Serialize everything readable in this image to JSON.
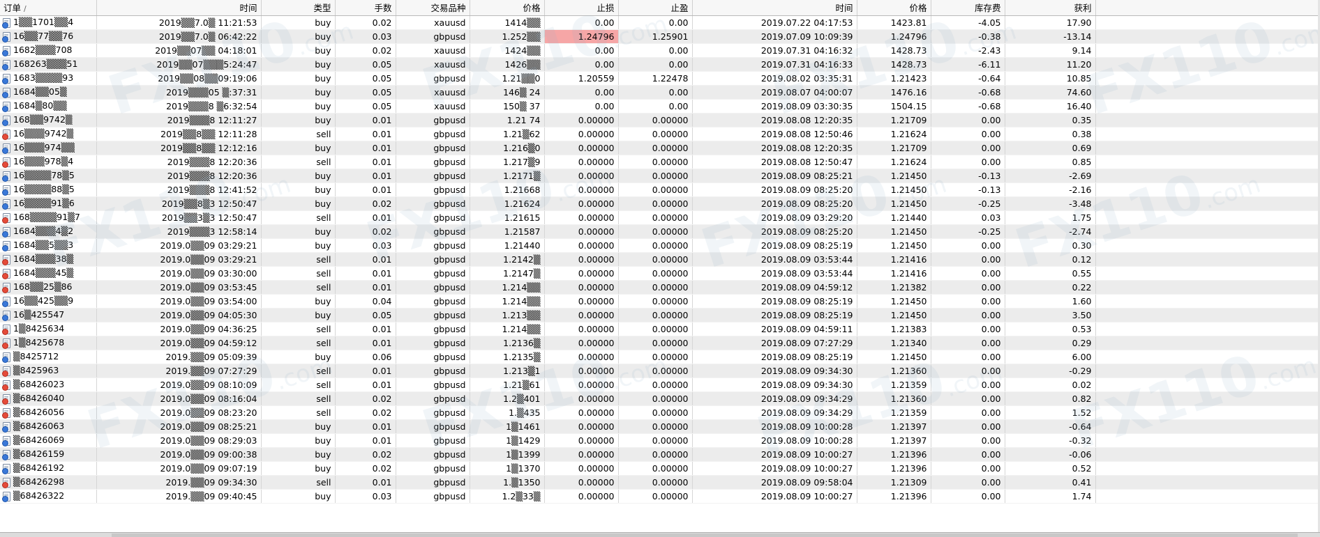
{
  "columns": [
    {
      "label": "订单",
      "sort": "∕"
    },
    {
      "label": "时间"
    },
    {
      "label": "类型"
    },
    {
      "label": "手数"
    },
    {
      "label": "交易品种"
    },
    {
      "label": "价格"
    },
    {
      "label": "止损"
    },
    {
      "label": "止盈"
    },
    {
      "label": "时间"
    },
    {
      "label": "价格"
    },
    {
      "label": "库存费"
    },
    {
      "label": "获利"
    }
  ],
  "watermark": {
    "brand": "FX110",
    "suffix": ".com"
  },
  "highlight": {
    "sl_color": "#f6a6a6",
    "buy_color": "#3a78d8",
    "sell_color": "#e44b3a"
  },
  "rows": [
    [
      "1▒▒1701▒▒4",
      "2019▒▒7.0▒ 11:21:53",
      "buy",
      "0.02",
      "xauusd",
      "1414▒▒",
      "0.00",
      "0.00",
      "2019.07.22 04:17:53",
      "1423.81",
      "-4.05",
      "17.90"
    ],
    [
      "16▒▒77▒▒76",
      "2019▒▒7.0▒ 06:42:22",
      "buy",
      "0.03",
      "gbpusd",
      "1.252▒▒",
      "1.24796",
      "1.25901",
      "2019.07.09 10:09:39",
      "1.24796",
      "-0.38",
      "-13.14"
    ],
    [
      "1682▒▒▒708",
      "2019▒▒07▒▒ 04:18:01",
      "buy",
      "0.02",
      "xauusd",
      "1424▒▒",
      "0.00",
      "0.00",
      "2019.07.31 04:16:32",
      "1428.73",
      "-2.43",
      "9.14"
    ],
    [
      "168263▒▒▒51",
      "2019▒▒07▒▒▒5:24:47",
      "buy",
      "0.05",
      "xauusd",
      "1426▒▒",
      "0.00",
      "0.00",
      "2019.07.31 04:16:33",
      "1428.73",
      "-6.11",
      "11.20"
    ],
    [
      "1683▒▒▒▒93",
      "2019▒▒08▒▒09:19:06",
      "buy",
      "0.05",
      "gbpusd",
      "1.21▒▒0",
      "1.20559",
      "1.22478",
      "2019.08.02 03:35:31",
      "1.21423",
      "-0.64",
      "10.85"
    ],
    [
      "1684▒▒05▒",
      "2019▒▒▒05 ▒:37:31",
      "buy",
      "0.05",
      "xauusd",
      "146▒ 24",
      "0.00",
      "0.00",
      "2019.08.07 04:00:07",
      "1476.16",
      "-0.68",
      "74.60"
    ],
    [
      "1684▒80▒▒",
      "2019▒▒▒8 ▒6:32:54",
      "buy",
      "0.05",
      "xauusd",
      "150▒ 37",
      "0.00",
      "0.00",
      "2019.08.09 03:30:35",
      "1504.15",
      "-0.68",
      "16.40"
    ],
    [
      "168▒▒9742▒",
      "2019▒▒▒8 12:11:27",
      "buy",
      "0.01",
      "gbpusd",
      "1.21 74",
      "0.00000",
      "0.00000",
      "2019.08.08 12:20:35",
      "1.21709",
      "0.00",
      "0.35"
    ],
    [
      "16▒▒▒9742▒",
      "2019▒▒8▒▒ 12:11:28",
      "sell",
      "0.01",
      "gbpusd",
      "1.21▒62",
      "0.00000",
      "0.00000",
      "2019.08.08 12:50:46",
      "1.21624",
      "0.00",
      "0.38"
    ],
    [
      "16▒▒▒974▒▒",
      "2019▒▒8▒▒ 12:12:16",
      "buy",
      "0.01",
      "gbpusd",
      "1.216▒0",
      "0.00000",
      "0.00000",
      "2019.08.08 12:20:35",
      "1.21709",
      "0.00",
      "0.69"
    ],
    [
      "16▒▒▒978▒4",
      "2019▒▒▒8 12:20:36",
      "sell",
      "0.01",
      "gbpusd",
      "1.217▒9",
      "0.00000",
      "0.00000",
      "2019.08.08 12:50:47",
      "1.21624",
      "0.00",
      "0.85"
    ],
    [
      "16▒▒▒▒78▒5",
      "2019▒▒▒8 12:20:36",
      "buy",
      "0.01",
      "gbpusd",
      "1.2171▒",
      "0.00000",
      "0.00000",
      "2019.08.09 08:25:21",
      "1.21450",
      "-0.13",
      "-2.69"
    ],
    [
      "16▒▒▒▒88▒5",
      "2019▒▒▒8 12:41:52",
      "buy",
      "0.01",
      "gbpusd",
      "1.21668",
      "0.00000",
      "0.00000",
      "2019.08.09 08:25:20",
      "1.21450",
      "-0.13",
      "-2.16"
    ],
    [
      "16▒▒▒▒91▒6",
      "2019▒▒8▒3 12:50:47",
      "buy",
      "0.02",
      "gbpusd",
      "1.21624",
      "0.00000",
      "0.00000",
      "2019.08.09 08:25:20",
      "1.21450",
      "-0.25",
      "-3.48"
    ],
    [
      "168▒▒▒▒91▒7",
      "2019▒▒3▒3 12:50:47",
      "sell",
      "0.01",
      "gbpusd",
      "1.21615",
      "0.00000",
      "0.00000",
      "2019.08.09 03:29:20",
      "1.21440",
      "0.03",
      "1.75"
    ],
    [
      "1684▒▒▒4▒2",
      "2019▒▒▒3 12:58:14",
      "buy",
      "0.02",
      "gbpusd",
      "1.21587",
      "0.00000",
      "0.00000",
      "2019.08.09 08:25:20",
      "1.21450",
      "-0.25",
      "-2.74"
    ],
    [
      "1684▒▒5▒▒3",
      "2019.0▒▒09 03:29:21",
      "buy",
      "0.03",
      "gbpusd",
      "1.21440",
      "0.00000",
      "0.00000",
      "2019.08.09 08:25:19",
      "1.21450",
      "0.00",
      "0.30"
    ],
    [
      "1684▒▒▒38▒",
      "2019.0▒▒09 03:29:21",
      "sell",
      "0.01",
      "gbpusd",
      "1.2142▒",
      "0.00000",
      "0.00000",
      "2019.08.09 03:53:44",
      "1.21416",
      "0.00",
      "0.12"
    ],
    [
      "1684▒▒▒45▒",
      "2019.0▒▒09 03:30:00",
      "sell",
      "0.01",
      "gbpusd",
      "1.2147▒",
      "0.00000",
      "0.00000",
      "2019.08.09 03:53:44",
      "1.21416",
      "0.00",
      "0.55"
    ],
    [
      "168▒▒25▒86",
      "2019.0▒▒09 03:53:45",
      "sell",
      "0.01",
      "gbpusd",
      "1.214▒▒",
      "0.00000",
      "0.00000",
      "2019.08.09 04:59:12",
      "1.21382",
      "0.00",
      "0.22"
    ],
    [
      "16▒▒425▒▒9",
      "2019.0▒▒09 03:54:00",
      "buy",
      "0.04",
      "gbpusd",
      "1.214▒▒",
      "0.00000",
      "0.00000",
      "2019.08.09 08:25:19",
      "1.21450",
      "0.00",
      "1.60"
    ],
    [
      "16▒425547",
      "2019.0▒▒09 04:05:30",
      "buy",
      "0.05",
      "gbpusd",
      "1.213▒▒",
      "0.00000",
      "0.00000",
      "2019.08.09 08:25:19",
      "1.21450",
      "0.00",
      "3.50"
    ],
    [
      "1▒8425634",
      "2019.0▒▒09 04:36:25",
      "sell",
      "0.01",
      "gbpusd",
      "1.214▒▒",
      "0.00000",
      "0.00000",
      "2019.08.09 04:59:11",
      "1.21383",
      "0.00",
      "0.53"
    ],
    [
      "1▒8425678",
      "2019.0▒▒09 04:59:12",
      "sell",
      "0.01",
      "gbpusd",
      "1.2136▒",
      "0.00000",
      "0.00000",
      "2019.08.09 07:27:29",
      "1.21340",
      "0.00",
      "0.29"
    ],
    [
      "▒8425712",
      "2019.▒▒09 05:09:39",
      "buy",
      "0.06",
      "gbpusd",
      "1.2135▒",
      "0.00000",
      "0.00000",
      "2019.08.09 08:25:19",
      "1.21450",
      "0.00",
      "6.00"
    ],
    [
      "▒8425963",
      "2019.▒▒09 07:27:29",
      "sell",
      "0.01",
      "gbpusd",
      "1.213▒1",
      "0.00000",
      "0.00000",
      "2019.08.09 09:34:30",
      "1.21360",
      "0.00",
      "-0.29"
    ],
    [
      "▒68426023",
      "2019.0▒▒09 08:10:09",
      "sell",
      "0.01",
      "gbpusd",
      "1.21▒61",
      "0.00000",
      "0.00000",
      "2019.08.09 09:34:30",
      "1.21359",
      "0.00",
      "0.02"
    ],
    [
      "▒68426040",
      "2019.0▒▒09 08:16:04",
      "sell",
      "0.02",
      "gbpusd",
      "1.2▒401",
      "0.00000",
      "0.00000",
      "2019.08.09 09:34:29",
      "1.21360",
      "0.00",
      "0.82"
    ],
    [
      "▒68426056",
      "2019.0▒▒09 08:23:20",
      "sell",
      "0.02",
      "gbpusd",
      "1.▒435",
      "0.00000",
      "0.00000",
      "2019.08.09 09:34:29",
      "1.21359",
      "0.00",
      "1.52"
    ],
    [
      "▒68426063",
      "2019.0▒▒09 08:25:21",
      "buy",
      "0.01",
      "gbpusd",
      "1▒1461",
      "0.00000",
      "0.00000",
      "2019.08.09 10:00:28",
      "1.21397",
      "0.00",
      "-0.64"
    ],
    [
      "▒68426069",
      "2019.0▒▒09 08:29:03",
      "buy",
      "0.01",
      "gbpusd",
      "1▒1429",
      "0.00000",
      "0.00000",
      "2019.08.09 10:00:28",
      "1.21397",
      "0.00",
      "-0.32"
    ],
    [
      "▒68426159",
      "2019.0▒▒09 09:00:38",
      "buy",
      "0.02",
      "gbpusd",
      "1▒1399",
      "0.00000",
      "0.00000",
      "2019.08.09 10:00:27",
      "1.21396",
      "0.00",
      "-0.06"
    ],
    [
      "▒68426192",
      "2019.0▒▒09 09:07:19",
      "buy",
      "0.02",
      "gbpusd",
      "1▒1370",
      "0.00000",
      "0.00000",
      "2019.08.09 10:00:27",
      "1.21396",
      "0.00",
      "0.52"
    ],
    [
      "▒68426298",
      "2019.▒▒09 09:34:30",
      "sell",
      "0.01",
      "gbpusd",
      "1.▒1350",
      "0.00000",
      "0.00000",
      "2019.08.09 09:58:04",
      "1.21309",
      "0.00",
      "0.41"
    ],
    [
      "▒68426322",
      "2019.▒▒09 09:40:45",
      "buy",
      "0.03",
      "gbpusd",
      "1.2▒33▒",
      "0.00000",
      "0.00000",
      "2019.08.09 10:00:27",
      "1.21396",
      "0.00",
      "1.74"
    ]
  ],
  "highlighted_cell": {
    "row": 1,
    "col": 6
  }
}
